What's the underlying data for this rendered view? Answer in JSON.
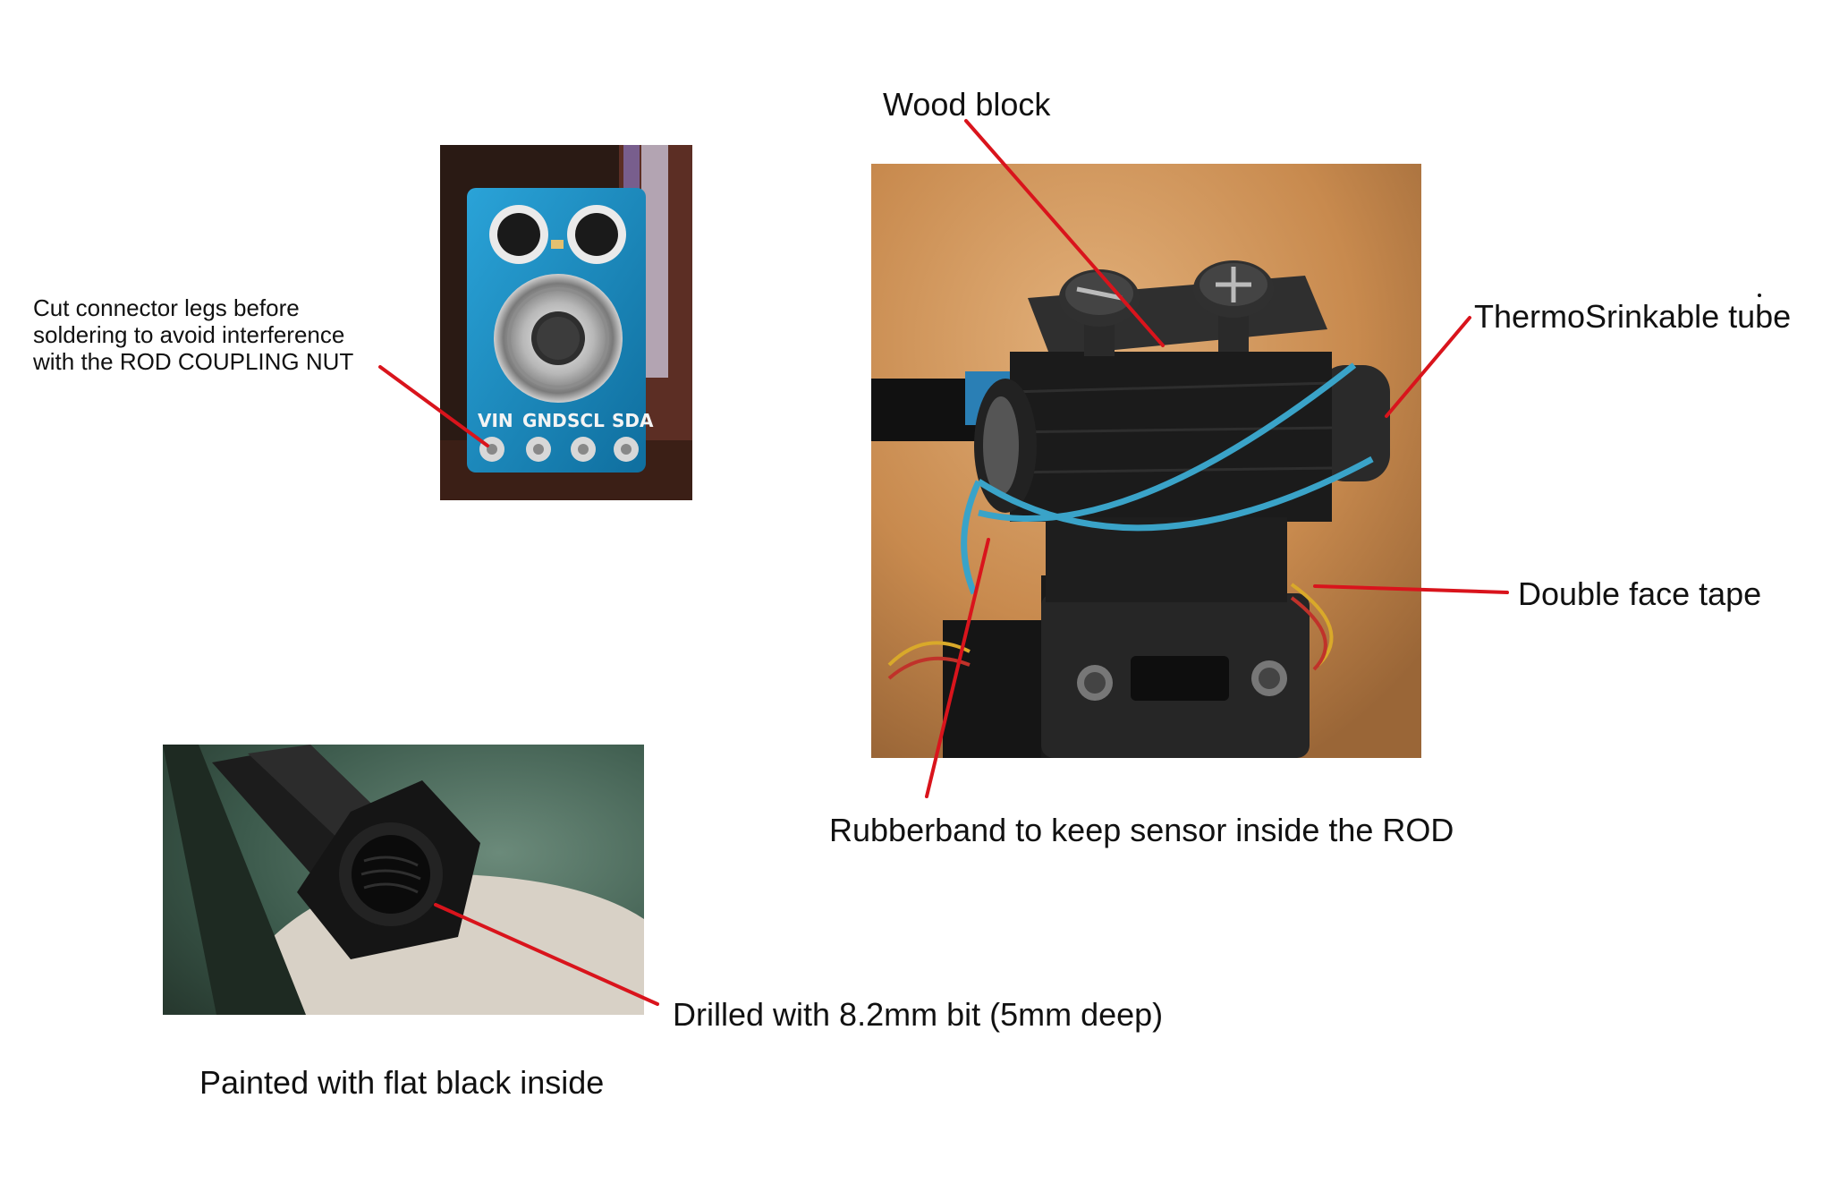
{
  "labels": {
    "connector_note": [
      "Cut connector legs before",
      "soldering to avoid interference",
      "with the ROD COUPLING NUT"
    ],
    "wood_block": "Wood block",
    "thermo_tube": "ThermoSrinkable tube",
    "double_tape": "Double face tape",
    "rubberband": "Rubberband to keep sensor inside the ROD",
    "drilled": "Drilled with 8.2mm bit (5mm deep)",
    "painted": "Painted with flat black inside"
  },
  "pin_labels": [
    "VIN",
    "GND",
    "SCL",
    "SDA"
  ],
  "colors": {
    "pointer": "#d9141c",
    "pcb_blue": "#1f8fc4",
    "wood_black": "#1b1b1b",
    "rubberband_blue": "#3aa3c8",
    "background_photo": "#c88a4e",
    "nut_background": "#3c5a4c"
  }
}
